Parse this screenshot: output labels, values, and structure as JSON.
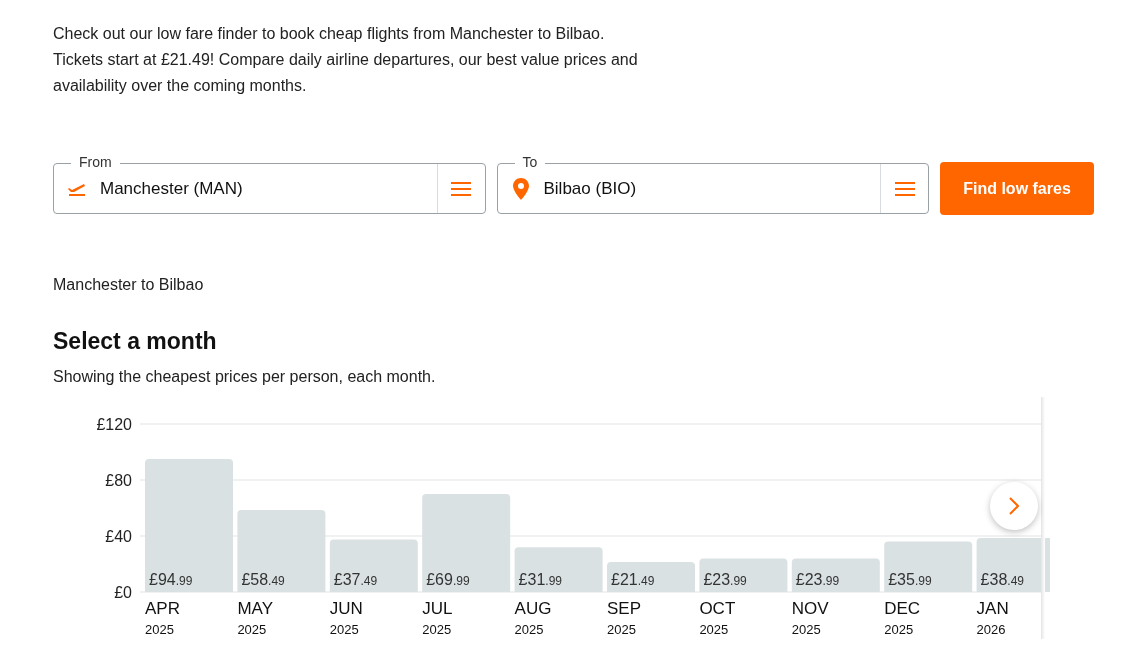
{
  "intro": "Check out our low fare finder to book cheap flights from Manchester to Bilbao. Tickets start at £21.49! Compare daily airline departures, our best value prices and availability over the coming months.",
  "search": {
    "fields": [
      {
        "kind": "origin",
        "label": "From",
        "value": "Manchester (MAN)"
      },
      {
        "kind": "destination",
        "label": "To",
        "value": "Bilbao (BIO)"
      }
    ],
    "button": "Find low fares"
  },
  "route": "Manchester to Bilbao",
  "month_picker": {
    "title": "Select a month",
    "subtitle": "Showing the cheapest prices per person, each month.",
    "chart_data": {
      "type": "bar",
      "categories": [
        "APR 2025",
        "MAY 2025",
        "JUN 2025",
        "JUL 2025",
        "AUG 2025",
        "SEP 2025",
        "OCT 2025",
        "NOV 2025",
        "DEC 2025",
        "JAN 2026"
      ],
      "series": [
        {
          "color": "#dae1e3",
          "values": [
            94.99,
            58.49,
            37.49,
            69.99,
            31.99,
            21.49,
            23.99,
            23.99,
            35.99,
            38.49
          ]
        }
      ],
      "ylim": [
        0,
        120
      ],
      "yticks": [
        {
          "value": 0,
          "label": "£0"
        },
        {
          "value": 40,
          "label": "£40"
        },
        {
          "value": 80,
          "label": "£80"
        },
        {
          "value": 120,
          "label": "£120"
        }
      ],
      "value_labels": [
        "£94.99",
        "£58.49",
        "£37.49",
        "£69.99",
        "£31.99",
        "£21.49",
        "£23.99",
        "£23.99",
        "£35.99",
        "£38.49"
      ]
    }
  }
}
